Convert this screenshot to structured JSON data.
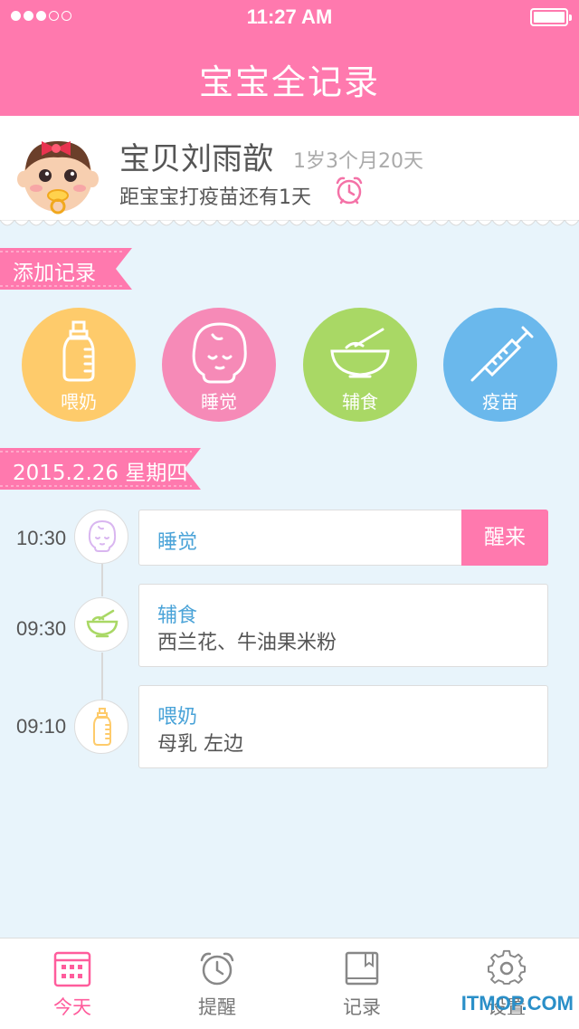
{
  "status_bar": {
    "time": "11:27  AM",
    "signal_filled": 3,
    "signal_total": 5
  },
  "header": {
    "title": "宝宝全记录"
  },
  "profile": {
    "name": "宝贝刘雨歆",
    "age": "1岁3个月20天",
    "vaccine_reminder": "距宝宝打疫苗还有1天"
  },
  "add_record": {
    "section_label": "添加记录",
    "buttons": [
      {
        "label": "喂奶",
        "icon": "bottle-icon",
        "color": "#fecb6b"
      },
      {
        "label": "睡觉",
        "icon": "sleeping-baby-icon",
        "color": "#f68ab7"
      },
      {
        "label": "辅食",
        "icon": "bowl-icon",
        "color": "#a9d865"
      },
      {
        "label": "疫苗",
        "icon": "syringe-icon",
        "color": "#6ab8ec"
      }
    ]
  },
  "timeline": {
    "date_label": "2015.2.26 星期四",
    "entries": [
      {
        "time": "10:30",
        "title": "睡觉",
        "detail": "",
        "action": "醒来",
        "icon": "sleeping-baby-icon"
      },
      {
        "time": "09:30",
        "title": "辅食",
        "detail": "西兰花、牛油果米粉",
        "icon": "bowl-icon"
      },
      {
        "time": "09:10",
        "title": "喂奶",
        "detail": "母乳 左边",
        "icon": "bottle-icon"
      }
    ]
  },
  "tabbar": {
    "tabs": [
      {
        "label": "今天",
        "icon": "calendar-icon",
        "active": true
      },
      {
        "label": "提醒",
        "icon": "alarm-clock-icon",
        "active": false
      },
      {
        "label": "记录",
        "icon": "book-icon",
        "active": false
      },
      {
        "label": "设置",
        "icon": "gear-icon",
        "active": false
      }
    ]
  },
  "watermark": "ITMOP.COM",
  "colors": {
    "brand_pink": "#ff79ae",
    "background": "#e8f4fb",
    "title_blue": "#4aa3d8"
  }
}
